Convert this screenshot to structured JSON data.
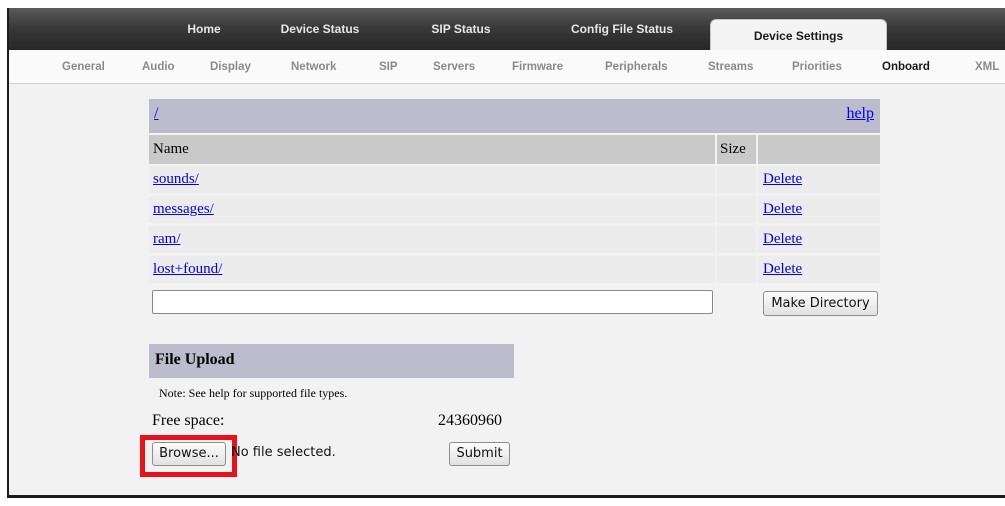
{
  "top_nav": {
    "tabs": [
      {
        "label": "Home"
      },
      {
        "label": "Device Status"
      },
      {
        "label": "SIP Status"
      },
      {
        "label": "Config File Status"
      },
      {
        "label": "Device Settings",
        "active": true
      }
    ]
  },
  "sub_nav": {
    "tabs": [
      {
        "label": "General"
      },
      {
        "label": "Audio"
      },
      {
        "label": "Display"
      },
      {
        "label": "Network"
      },
      {
        "label": "SIP"
      },
      {
        "label": "Servers"
      },
      {
        "label": "Firmware"
      },
      {
        "label": "Peripherals"
      },
      {
        "label": "Streams"
      },
      {
        "label": "Priorities"
      },
      {
        "label": "Onboard",
        "active": true
      },
      {
        "label": "XML"
      }
    ]
  },
  "file_browser": {
    "path": "/",
    "help_label": "help",
    "columns": {
      "name": "Name",
      "size": "Size"
    },
    "entries": [
      {
        "name": "sounds/",
        "size": "",
        "action": "Delete"
      },
      {
        "name": "messages/",
        "size": "",
        "action": "Delete"
      },
      {
        "name": "ram/",
        "size": "",
        "action": "Delete"
      },
      {
        "name": "lost+found/",
        "size": "",
        "action": "Delete"
      }
    ],
    "new_dir_value": "",
    "make_dir_label": "Make Directory"
  },
  "upload": {
    "title": "File Upload",
    "note": "Note: See help for supported file types.",
    "free_space_label": "Free space:",
    "free_space_value": "24360960",
    "browse_label": "Browse...",
    "no_file_text": "No file selected.",
    "submit_label": "Submit"
  },
  "colors": {
    "header_band": "#bdbccd",
    "column_header": "#c9c9c9",
    "row_bg": "#ececec",
    "link": "#0000ee",
    "highlight_box": "#e8121b"
  }
}
